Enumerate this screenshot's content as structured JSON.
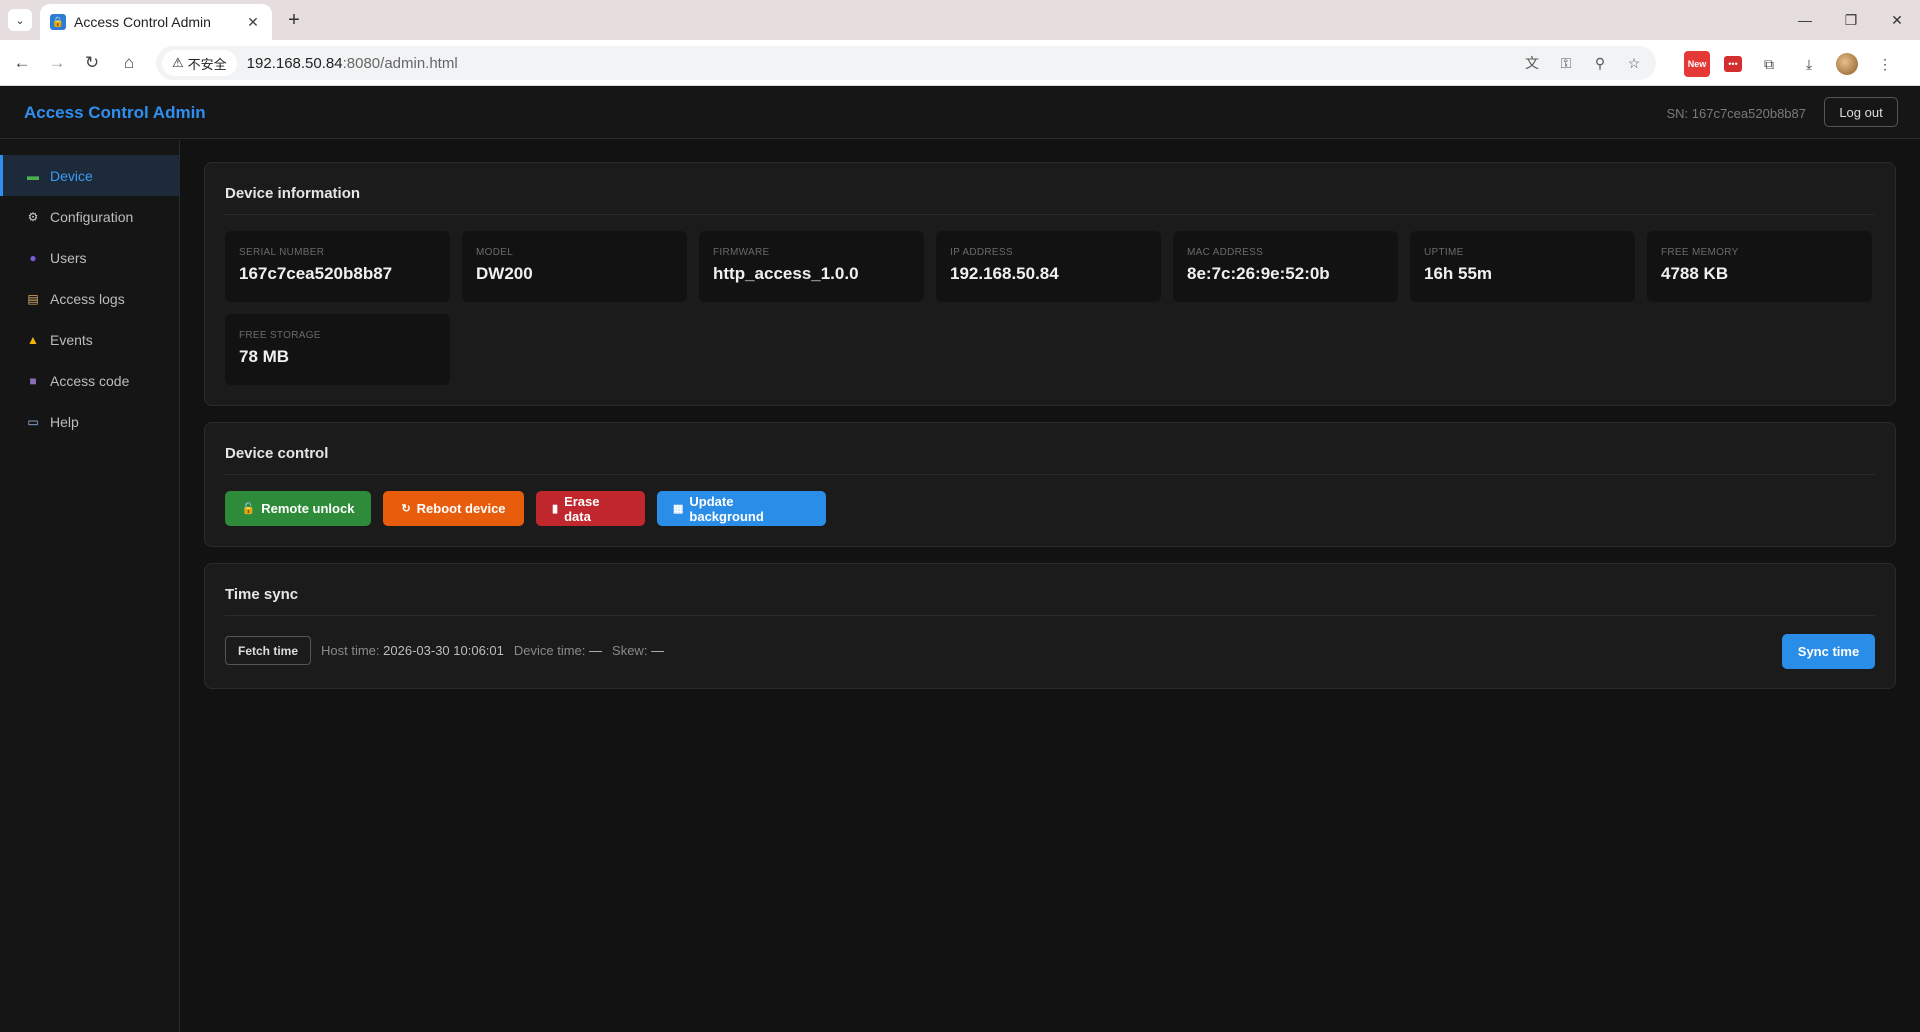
{
  "browser": {
    "tab_title": "Access Control Admin",
    "security_label": "不安全",
    "url_host": "192.168.50.84",
    "url_rest": ":8080/admin.html",
    "ext_new_label": "New"
  },
  "header": {
    "brand": "Access Control Admin",
    "sn": "SN: 167c7cea520b8b87",
    "logout_label": "Log out"
  },
  "sidebar": {
    "items": [
      {
        "label": "Device",
        "icon": "monitor-icon",
        "active": true
      },
      {
        "label": "Configuration",
        "icon": "gear-icon"
      },
      {
        "label": "Users",
        "icon": "user-icon"
      },
      {
        "label": "Access logs",
        "icon": "clipboard-icon"
      },
      {
        "label": "Events",
        "icon": "warning-icon"
      },
      {
        "label": "Access code",
        "icon": "qr-square-icon"
      },
      {
        "label": "Help",
        "icon": "book-icon"
      }
    ]
  },
  "device_info": {
    "title": "Device information",
    "fields": [
      {
        "label": "SERIAL NUMBER",
        "value": "167c7cea520b8b87"
      },
      {
        "label": "MODEL",
        "value": "DW200"
      },
      {
        "label": "FIRMWARE",
        "value": "http_access_1.0.0"
      },
      {
        "label": "IP ADDRESS",
        "value": "192.168.50.84"
      },
      {
        "label": "MAC ADDRESS",
        "value": "8e:7c:26:9e:52:0b"
      },
      {
        "label": "UPTIME",
        "value": "16h 55m"
      },
      {
        "label": "FREE MEMORY",
        "value": "4788 KB"
      },
      {
        "label": "FREE STORAGE",
        "value": "78 MB"
      }
    ]
  },
  "device_control": {
    "title": "Device control",
    "remote_unlock": "Remote unlock",
    "reboot": "Reboot device",
    "erase": "Erase data",
    "update_bg": "Update background"
  },
  "time_sync": {
    "title": "Time sync",
    "fetch_label": "Fetch time",
    "host_time_label": "Host time:",
    "host_time_value": "2026-03-30 10:06:01",
    "device_time_label": "Device time:",
    "device_time_value": "—",
    "skew_label": "Skew:",
    "skew_value": "—",
    "sync_label": "Sync time"
  },
  "colors": {
    "accent": "#2f8ff0",
    "green": "#2e8b3a",
    "orange": "#e85d0c",
    "red": "#c0282d",
    "blue": "#2a8de8"
  }
}
